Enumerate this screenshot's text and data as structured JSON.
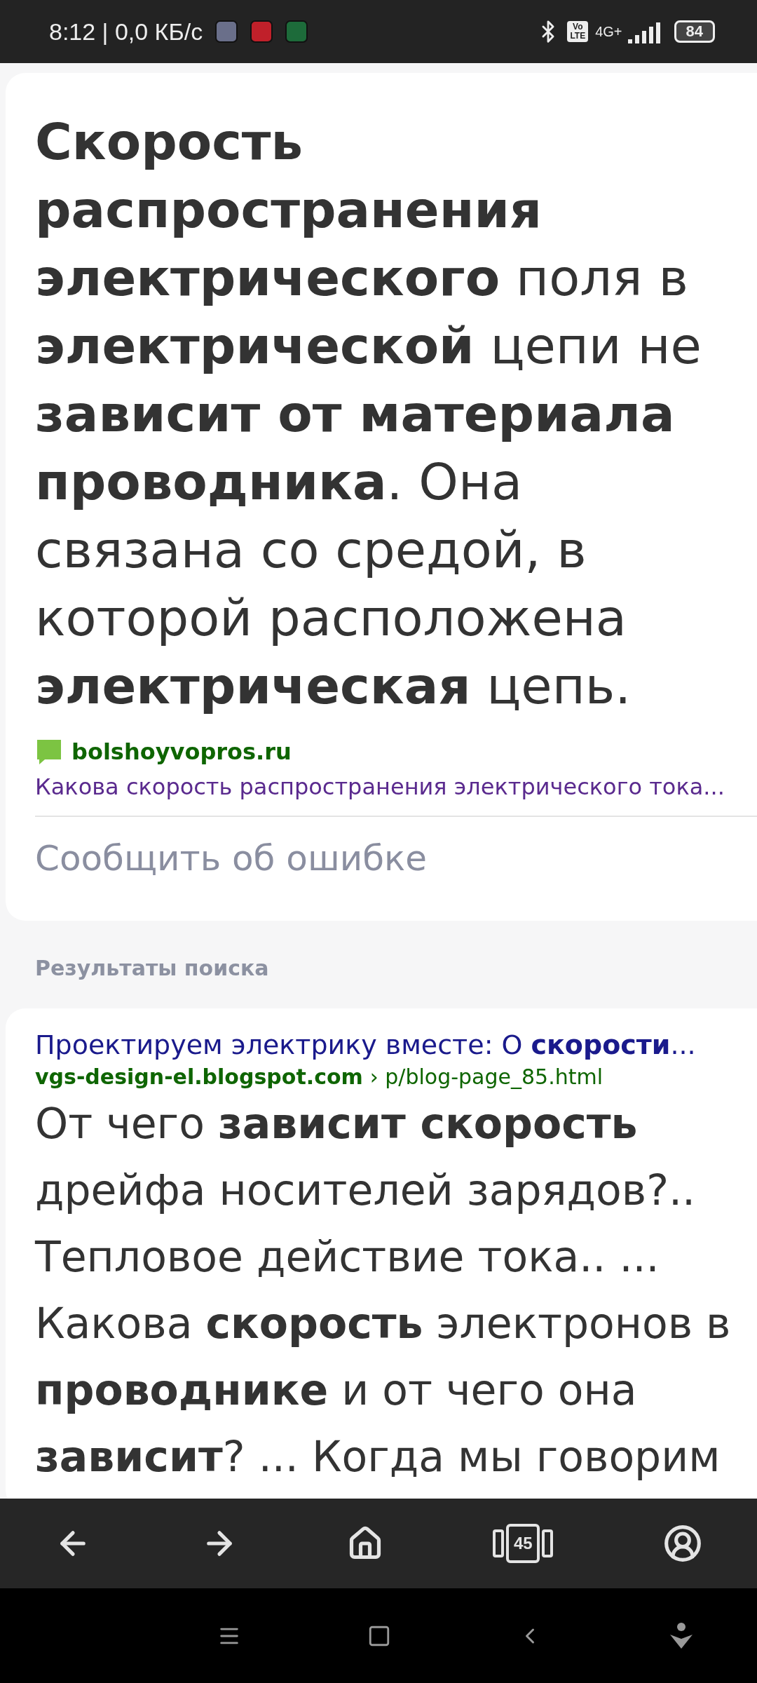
{
  "status_bar": {
    "time_speed": "8:12 | 0,0 КБ/с",
    "volte_top": "Vo",
    "volte_bottom": "LTE",
    "network": "4G+",
    "battery": "84"
  },
  "answer": {
    "lines": [
      "**Скорость**",
      "**распространения**",
      "**электрического** поля в",
      "**электрической** цепи не",
      "**зависит от материала**",
      "**проводника**. Она",
      "связана со средой, в",
      "которой расположена",
      "**электрическая** цепь."
    ],
    "source": {
      "site": "bolshoyvopros.ru",
      "title": "Какова скорость распространения электрического тока..."
    },
    "report": "Сообщить об ошибке"
  },
  "section_title": "Результаты поиска",
  "results": [
    {
      "title": "Проектируем электрику вместе: О **скорости**...",
      "domain": "vgs-design-el.blogspot.com",
      "path": "› p/blog-page_85.html",
      "snippet_lines": [
        "От чего **зависит скорость**",
        "дрейфа носителей зарядов?..",
        "Тепловое действие тока.. ...",
        "Какова **скорость** электронов в",
        "**проводнике** и от чего она",
        "**зависит**? ... Когда мы говорим"
      ]
    }
  ],
  "toolbar": {
    "tabs_count": "45"
  }
}
